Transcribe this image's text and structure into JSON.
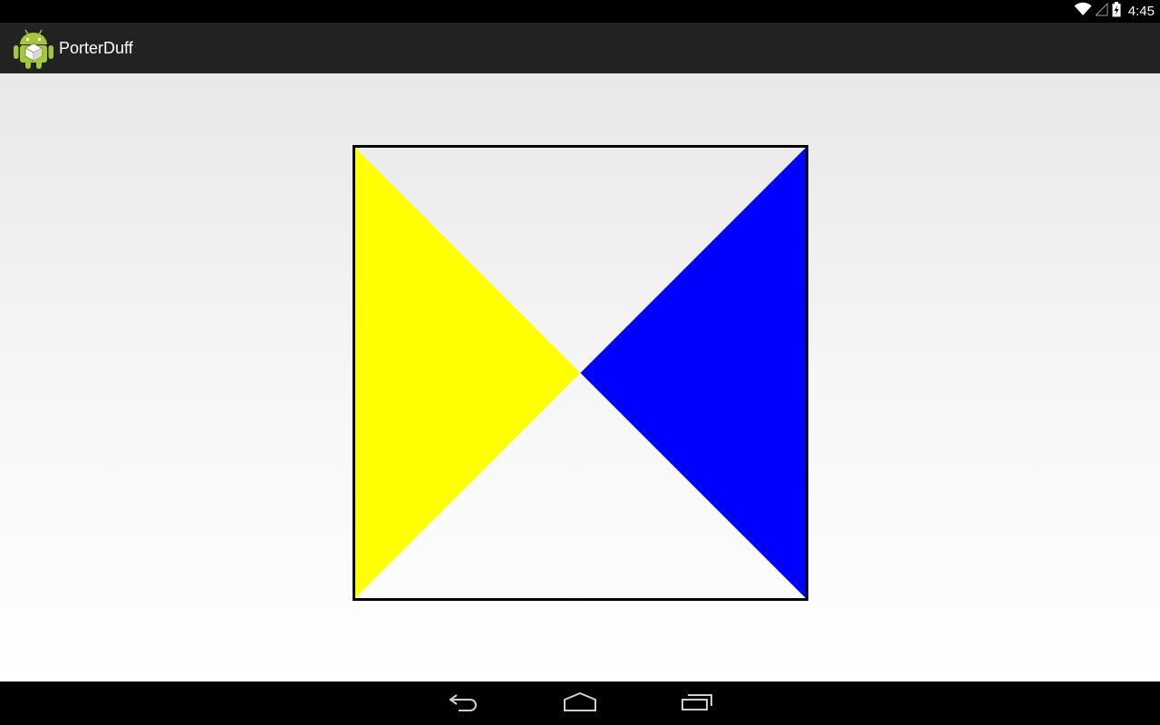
{
  "status_bar": {
    "time": "4:45",
    "icons": [
      "wifi-icon",
      "signal-icon",
      "battery-icon"
    ]
  },
  "action_bar": {
    "app_icon": "android-robot-icon",
    "title": "PorterDuff"
  },
  "canvas": {
    "shapes": [
      {
        "name": "yellow-triangle",
        "color": "#ffff00"
      },
      {
        "name": "blue-triangle",
        "color": "#0000ff"
      }
    ],
    "border_color": "#000000"
  },
  "nav_bar": {
    "buttons": [
      "back-icon",
      "home-icon",
      "recents-icon"
    ]
  },
  "colors": {
    "status_bar": "#000000",
    "action_bar": "#222222",
    "nav_bar": "#000000"
  }
}
